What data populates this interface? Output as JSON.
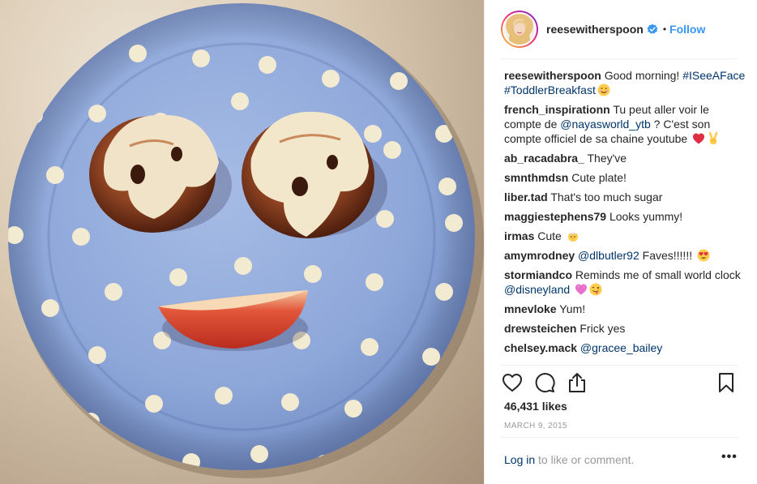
{
  "post": {
    "username": "reesewitherspoon",
    "follow_label": "Follow",
    "separator": "•"
  },
  "comments": [
    {
      "user": "reesewitherspoon",
      "parts": [
        {
          "t": "text",
          "v": "Good morning! "
        },
        {
          "t": "link",
          "v": "#ISeeAFace"
        },
        {
          "t": "text",
          "v": " "
        },
        {
          "t": "link",
          "v": "#ToddlerBreakfast"
        },
        {
          "t": "emoji",
          "v": "smile"
        }
      ]
    },
    {
      "user": "french_inspirationn",
      "parts": [
        {
          "t": "text",
          "v": "Tu peut aller voir le compte de "
        },
        {
          "t": "link",
          "v": "@nayasworld_ytb"
        },
        {
          "t": "text",
          "v": " ? C'est son compte officiel de sa chaine youtube "
        },
        {
          "t": "emoji",
          "v": "heart"
        },
        {
          "t": "emoji",
          "v": "victory"
        }
      ]
    },
    {
      "user": "ab_racadabra_",
      "parts": [
        {
          "t": "text",
          "v": "They've"
        }
      ]
    },
    {
      "user": "smnthmdsn",
      "parts": [
        {
          "t": "text",
          "v": "Cute plate!"
        }
      ]
    },
    {
      "user": "liber.tad",
      "parts": [
        {
          "t": "text",
          "v": "That's too much sugar"
        }
      ]
    },
    {
      "user": "maggiestephens79",
      "parts": [
        {
          "t": "text",
          "v": "Looks yummy!"
        }
      ]
    },
    {
      "user": "irmas",
      "parts": [
        {
          "t": "text",
          "v": "Cute "
        },
        {
          "t": "emoji",
          "v": "chick"
        }
      ]
    },
    {
      "user": "amymrodney",
      "parts": [
        {
          "t": "link",
          "v": "@dlbutler92"
        },
        {
          "t": "text",
          "v": " Faves!!!!!! "
        },
        {
          "t": "emoji",
          "v": "heart-eyes"
        }
      ]
    },
    {
      "user": "stormiandco",
      "parts": [
        {
          "t": "text",
          "v": "Reminds me of small world clock "
        },
        {
          "t": "link",
          "v": "@disneyland"
        },
        {
          "t": "text",
          "v": " "
        },
        {
          "t": "emoji",
          "v": "pink-heart"
        },
        {
          "t": "emoji",
          "v": "wink-tongue"
        }
      ]
    },
    {
      "user": "mnevloke",
      "parts": [
        {
          "t": "text",
          "v": "Yum!"
        }
      ]
    },
    {
      "user": "drewsteichen",
      "parts": [
        {
          "t": "text",
          "v": "Frick yes"
        }
      ]
    },
    {
      "user": "chelsey.mack",
      "parts": [
        {
          "t": "link",
          "v": "@gracee_bailey"
        }
      ]
    }
  ],
  "actions": {
    "like_icon": "heart-outline-icon",
    "comment_icon": "comment-bubble-icon",
    "share_icon": "share-icon",
    "save_icon": "bookmark-icon"
  },
  "stats": {
    "likes": "46,431 likes",
    "date": "MARCH 9, 2015"
  },
  "footer": {
    "login_link": "Log in",
    "login_rest": " to like or comment.",
    "more_label": "•••"
  },
  "colors": {
    "accent": "#3897f0",
    "link": "#003569",
    "muted": "#999999",
    "text": "#262626",
    "plate": "#8fa8d8",
    "heart": "#ed4956"
  }
}
